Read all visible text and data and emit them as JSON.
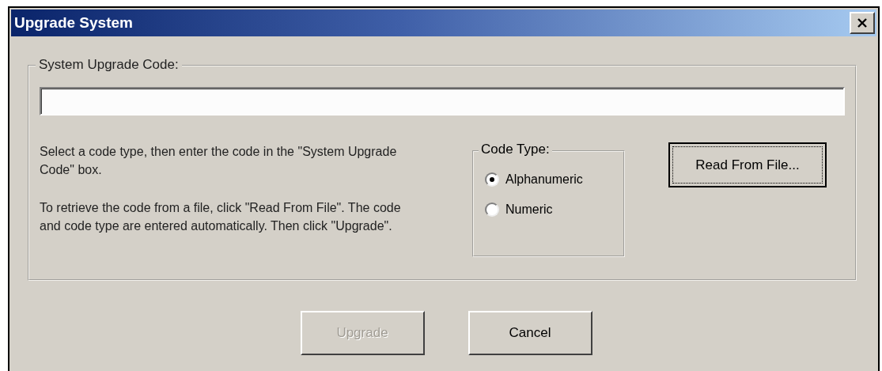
{
  "window": {
    "title": "Upgrade System"
  },
  "code_group": {
    "label": "System Upgrade Code:",
    "instructions": [
      "Select a code type, then enter the code in the \"System Upgrade Code\" box.",
      "To retrieve the code from a file, click \"Read From File\". The code and code type are entered automatically. Then click \"Upgrade\"."
    ],
    "code_type": {
      "label": "Code Type:",
      "options": [
        {
          "label": "Alphanumeric",
          "selected": true
        },
        {
          "label": "Numeric",
          "selected": false
        }
      ]
    },
    "read_button": {
      "label": "Read From File...",
      "focused": true
    }
  },
  "buttons": [
    {
      "label": "Upgrade",
      "disabled": true
    },
    {
      "label": "Cancel",
      "disabled": false
    }
  ]
}
